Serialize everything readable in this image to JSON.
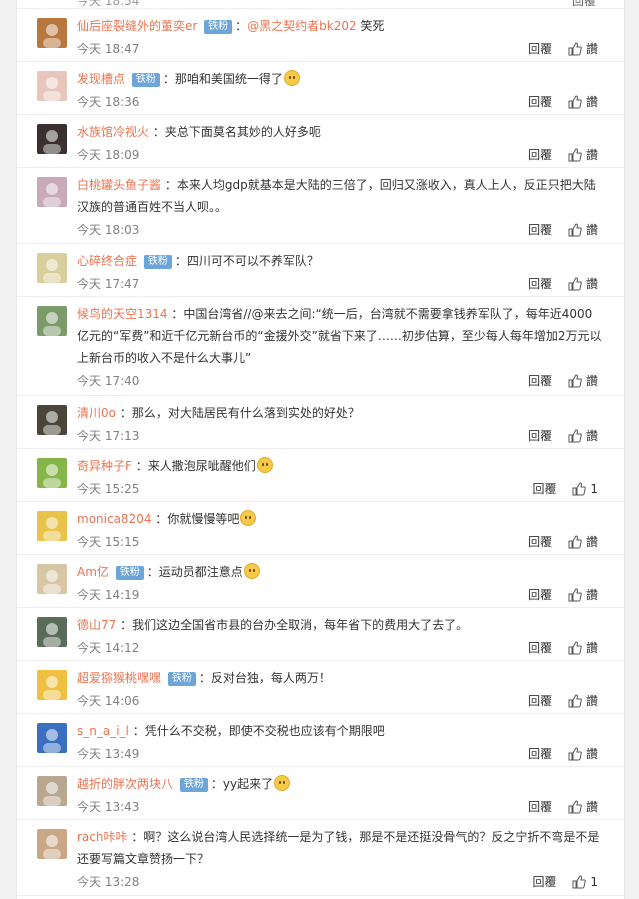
{
  "top": {
    "time": "今天 18:54",
    "reply_label": "回覆"
  },
  "comments": [
    {
      "user": "仙后座裂缝外的董奕er",
      "badge": "铁粉",
      "mention": "@黑之契约者bk202",
      "content": "笑死",
      "emoji": "",
      "time": "今天 18:47",
      "reply": "回覆",
      "like": "讚",
      "avatar_color": "#b7773d"
    },
    {
      "user": "发现槽点",
      "badge": "铁粉",
      "mention": "",
      "content": "那咱和美国统一得了",
      "emoji": "emoji-face",
      "time": "今天 18:36",
      "reply": "回覆",
      "like": "讚",
      "avatar_color": "#e7c6bc"
    },
    {
      "user": "水族馆冷视火",
      "badge": "",
      "mention": "",
      "content": "夹总下面莫名其妙的人好多呃",
      "emoji": "",
      "time": "今天 18:09",
      "reply": "回覆",
      "like": "讚",
      "avatar_color": "#3a3030"
    },
    {
      "user": "白桃罐头鱼子酱",
      "badge": "",
      "mention": "",
      "content": "本来人均gdp就基本是大陆的三倍了，回归又涨收入，真人上人，反正只把大陆汉族的普通百姓不当人呗。。",
      "emoji": "",
      "time": "今天 18:03",
      "reply": "回覆",
      "like": "讚",
      "avatar_color": "#c9a8b8"
    },
    {
      "user": "心碎终合症",
      "badge": "铁粉",
      "mention": "",
      "content": "四川可不可以不养军队？",
      "emoji": "",
      "time": "今天 17:47",
      "reply": "回覆",
      "like": "讚",
      "avatar_color": "#d9cf9c"
    },
    {
      "user": "候鸟的天空1314",
      "badge": "",
      "mention": "",
      "content": "中国台湾省//@来去之间:“统一后，台湾就不需要拿钱养军队了，每年近4000亿元的“军费”和近千亿元新台币的“金援外交”就省下来了……初步估算，至少每人每年增加2万元以上新台币的收入不是什么大事儿”",
      "emoji": "",
      "time": "今天 17:40",
      "reply": "回覆",
      "like": "讚",
      "avatar_color": "#7c9a6a"
    },
    {
      "user": "清川0o",
      "badge": "",
      "mention": "",
      "content": "那么，对大陆居民有什么落到实处的好处？",
      "emoji": "",
      "time": "今天 17:13",
      "reply": "回覆",
      "like": "讚",
      "avatar_color": "#4a4538"
    },
    {
      "user": "奇异种子F",
      "badge": "",
      "mention": "",
      "content": "来人撒泡尿呲醒他们",
      "emoji": "emoji-dog",
      "time": "今天 15:25",
      "reply": "回覆",
      "like": "1",
      "avatar_color": "#86b54a"
    },
    {
      "user": "monica8204",
      "badge": "",
      "mention": "",
      "content": "你就慢慢等吧",
      "emoji": "emoji-face",
      "time": "今天 15:15",
      "reply": "回覆",
      "like": "讚",
      "avatar_color": "#e9c24a"
    },
    {
      "user": "Am亿",
      "badge": "铁粉",
      "mention": "",
      "content": "运动员都注意点",
      "emoji": "emoji-dog",
      "time": "今天 14:19",
      "reply": "回覆",
      "like": "讚",
      "avatar_color": "#d8c7a4"
    },
    {
      "user": "德山77",
      "badge": "",
      "mention": "",
      "content": "我们这边全国省市县的台办全取消，每年省下的费用大了去了。",
      "emoji": "",
      "time": "今天 14:12",
      "reply": "回覆",
      "like": "讚",
      "avatar_color": "#5b6b5a"
    },
    {
      "user": "超爱猕猴桃嘿嘿",
      "badge": "铁粉",
      "mention": "",
      "content": "反对台独，每人两万！",
      "emoji": "",
      "time": "今天 14:06",
      "reply": "回覆",
      "like": "讚",
      "avatar_color": "#f0c040"
    },
    {
      "user": "s_n_a_i_l",
      "badge": "",
      "mention": "",
      "content": "凭什么不交税，即使不交税也应该有个期限吧",
      "emoji": "",
      "time": "今天 13:49",
      "reply": "回覆",
      "like": "讚",
      "avatar_color": "#3b6fc2"
    },
    {
      "user": "越折的胖次两块八",
      "badge": "铁粉",
      "mention": "",
      "content": "yy起来了",
      "emoji": "emoji-face",
      "time": "今天 13:43",
      "reply": "回覆",
      "like": "讚",
      "avatar_color": "#b9a890"
    },
    {
      "user": "rach咔咔",
      "badge": "",
      "mention": "",
      "content": "啊？这么说台湾人民选择统一是为了钱，那是不是还挺没骨气的？反之宁折不弯是不是还要写篇文章赞扬一下？",
      "emoji": "",
      "time": "今天 13:28",
      "reply": "回覆",
      "like": "1",
      "avatar_color": "#c9a888"
    }
  ]
}
